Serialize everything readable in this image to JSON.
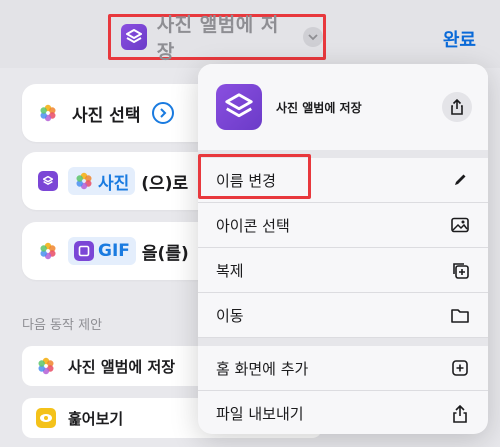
{
  "header": {
    "title": "사진 앨범에 저장",
    "done_label": "완료"
  },
  "actions": [
    {
      "label": "사진 선택",
      "icon": "photos-icon"
    },
    {
      "variable": "사진",
      "tail": "(으)로",
      "icon": "photos-icon"
    },
    {
      "variable": "GIF",
      "tail": "을(를)",
      "icon": "photos-icon"
    }
  ],
  "suggestions": {
    "title": "다음 동작 제안",
    "items": [
      {
        "label": "사진 앨범에 저장",
        "icon": "photos-icon"
      },
      {
        "label": "훑어보기",
        "icon": "eye-icon"
      }
    ]
  },
  "menu": {
    "title": "사진 앨범에 저장",
    "items": [
      {
        "label": "이름 변경",
        "icon": "pencil-icon"
      },
      {
        "label": "아이콘 선택",
        "icon": "photo-icon"
      },
      {
        "label": "복제",
        "icon": "duplicate-icon"
      },
      {
        "label": "이동",
        "icon": "folder-icon"
      },
      {
        "label": "홈 화면에 추가",
        "icon": "add-square-icon"
      },
      {
        "label": "파일 내보내기",
        "icon": "share-icon"
      }
    ]
  },
  "colors": {
    "accent": "#0a6ad8",
    "highlight": "#e8383d",
    "shortcut_purple": "#7b46d6"
  }
}
